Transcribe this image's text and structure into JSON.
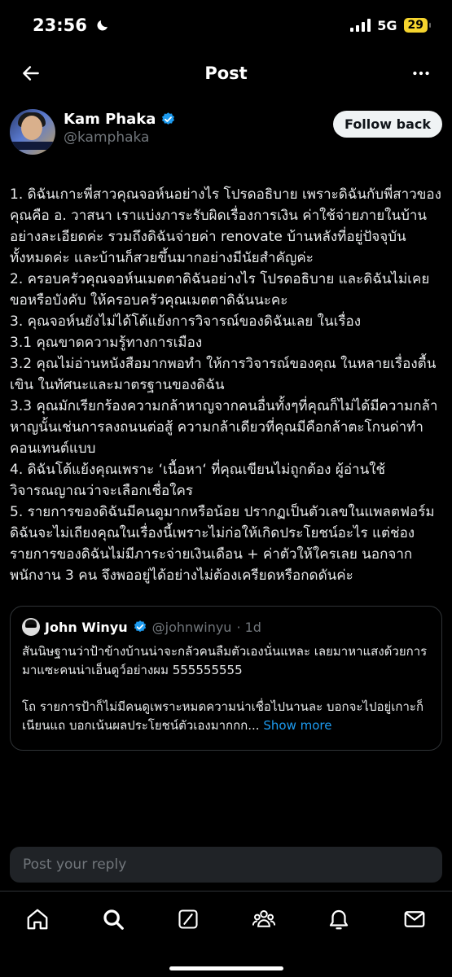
{
  "status_bar": {
    "time": "23:56",
    "network": "5G",
    "battery": "29"
  },
  "header": {
    "title": "Post"
  },
  "post": {
    "author_name": "Kam Phaka",
    "author_handle": "@kamphaka",
    "follow_label": "Follow back",
    "body": [
      "1. ดิฉันเกาะพี่สาวคุณจอห์นอย่างไร โปรดอธิบาย เพราะดิฉันกับพี่สาวของคุณคือ อ. วาสนา เราแบ่งภาระรับผิดเรื่องการเงิน ค่าใช้จ่ายภายในบ้านอย่างละเอียดค่ะ รวมถึงดิฉันจ่ายค่า renovate บ้านหลังที่อยู่ปัจจุบันทั้งหมดค่ะ และบ้านก็สวยขึ้นมากอย่างมีนัยสำคัญค่ะ",
      "2. ครอบครัวคุณจอห์นเมตตาดิฉันอย่างไร โปรดอธิบาย และดิฉันไม่เคยขอหรือบังคับ ให้ครอบครัวคุณเมตตาดิฉันนะคะ",
      "3. คุณจอห์นยังไม่ได้โต้แย้งการวิจารณ์ของดิฉันเลย ในเรื่อง",
      "3.1 คุณขาดความรู้ทางการเมือง",
      "3.2 คุณไม่อ่านหนังสือมากพอทำ ให้การวิจารณ์ของคุณ ในหลายเรื่องตื้นเขิน ในทัศนะและมาตรฐานของดิฉัน",
      "3.3 คุณมักเรียกร้องความกล้าหาญจากคนอื่นทั้งๆที่คุณก็ไม่ได้มีความกล้าหาญนั้นเช่นการลงถนนต่อสู้ ความกล้าเดียวที่คุณมีคือกล้าตะโกนด่าทำคอนเทนต์แบบ",
      "4. ดิฉันโต้แย้งคุณเพราะ ‘เนื้อหา‘ ที่คุณเขียนไม่ถูกต้อง ผู้อ่านใช้วิจารณญาณว่าจะเลือกเชื่อใคร",
      "5. รายการของดิฉันมีคนดูมากหรือน้อย ปรากฏเป็นตัวเลขในแพลตฟอร์ม ดิฉันจะไม่เถียงคุณในเรื่องนี้เพราะไม่ก่อให้เกิดประโยชน์อะไร แต่ช่องรายการของดิฉันไม่มีภาระจ่ายเงินเดือน + ค่าตัวให้ใครเลย นอกจากพนักงาน 3 คน จึงพออยู่ได้อย่างไม่ต้องเครียดหรือกดดันค่ะ"
    ]
  },
  "quote": {
    "author_name": "John Winyu",
    "author_handle": "@johnwinyu",
    "time": "· 1d",
    "paragraph_1": "สันนิษฐานว่าป้าข้างบ้านน่าจะกลัวคนลืมตัวเองนั่นแหละ เลยมาหาแสงด้วยการมาแซะคนน่าเอ็นดูว์อย่างผม 555555555",
    "paragraph_2": "โถ รายการป้าก็ไม่มีคนดูเพราะหมดความน่าเชื่อไปนานละ บอกจะไปอยู่เกาะก็เนียนแถ บอกเน้นผลประโยชน์ตัวเองมากกก...",
    "show_more": "Show more"
  },
  "reply": {
    "placeholder": "Post your reply"
  },
  "colors": {
    "background": "#000000",
    "text": "#e7e9ea",
    "secondary_text": "#71767b",
    "accent_blue": "#1d9bf0",
    "battery_yellow": "#f5d42e"
  },
  "icons": {
    "back": "arrow-left-icon",
    "more": "more-horizontal-icon",
    "verified": "verified-badge-icon",
    "tabs": [
      "home-icon",
      "search-icon",
      "grok-icon",
      "communities-icon",
      "notifications-icon",
      "messages-icon"
    ]
  }
}
